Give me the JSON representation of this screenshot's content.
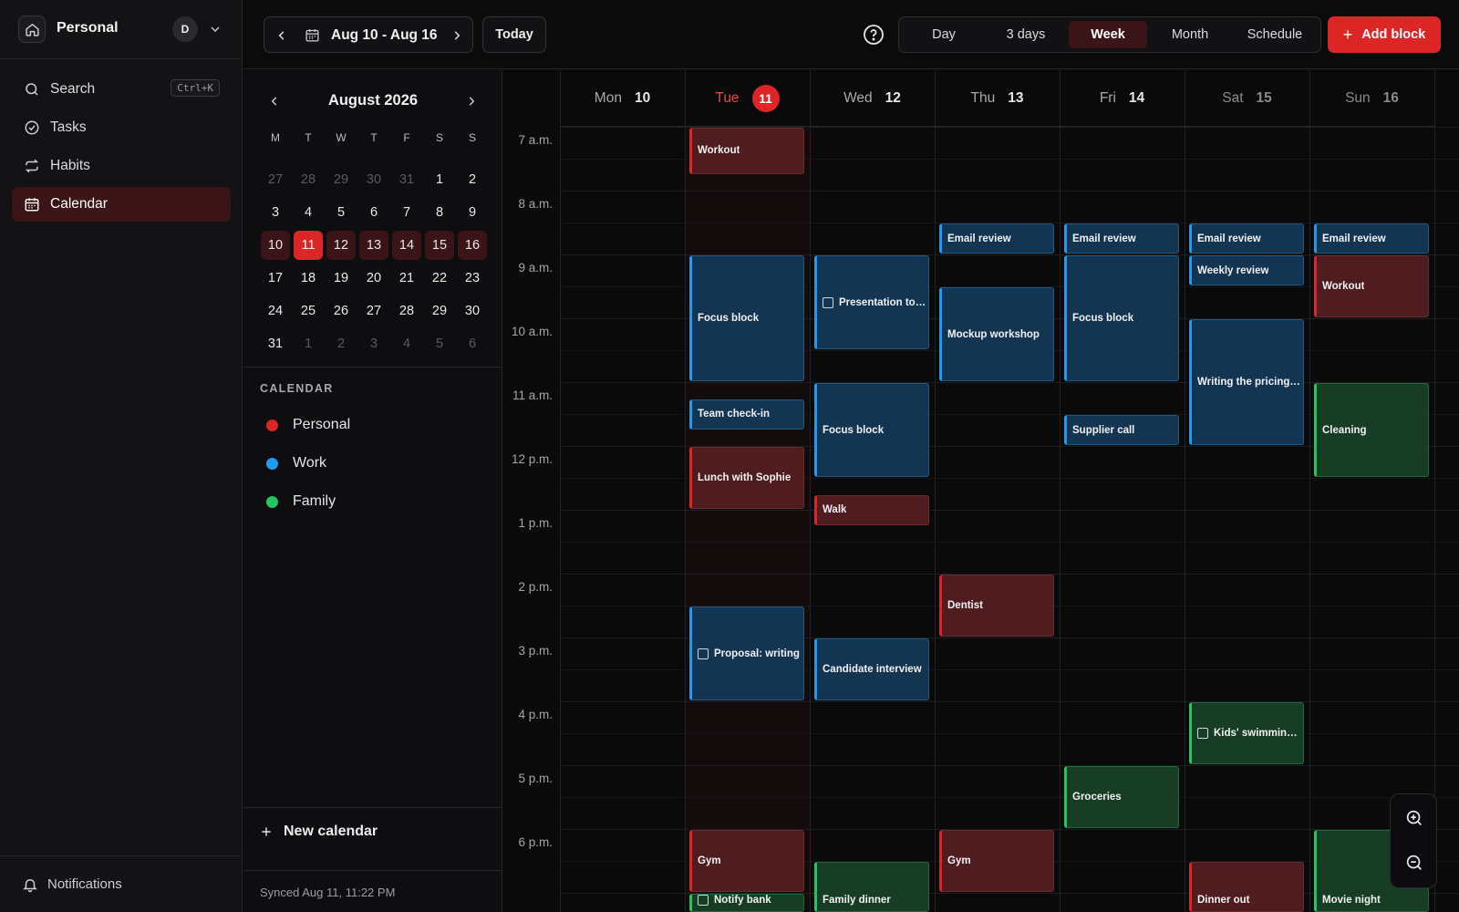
{
  "sidebar": {
    "workspace": {
      "name": "Personal",
      "avatar": "D",
      "home_icon": "home-icon",
      "chevron_icon": "chevron-down-icon"
    },
    "nav": [
      {
        "label": "Search",
        "icon": "search-icon",
        "shortcut": "Ctrl+K",
        "active": false
      },
      {
        "label": "Tasks",
        "icon": "check-circle-icon",
        "active": false
      },
      {
        "label": "Habits",
        "icon": "repeat-icon",
        "active": false
      },
      {
        "label": "Calendar",
        "icon": "calendar-icon",
        "active": true
      }
    ],
    "notifications": {
      "label": "Notifications",
      "icon": "bell-icon"
    }
  },
  "mini_calendar": {
    "title": "August 2026",
    "weekdays": [
      "M",
      "T",
      "W",
      "T",
      "F",
      "S",
      "S"
    ],
    "weeks": [
      [
        {
          "d": "27",
          "muted": true
        },
        {
          "d": "28",
          "muted": true
        },
        {
          "d": "29",
          "muted": true
        },
        {
          "d": "30",
          "muted": true
        },
        {
          "d": "31",
          "muted": true
        },
        {
          "d": "1"
        },
        {
          "d": "2"
        }
      ],
      [
        {
          "d": "3"
        },
        {
          "d": "4"
        },
        {
          "d": "5"
        },
        {
          "d": "6"
        },
        {
          "d": "7"
        },
        {
          "d": "8"
        },
        {
          "d": "9"
        }
      ],
      [
        {
          "d": "10",
          "inweek": true
        },
        {
          "d": "11",
          "today": true
        },
        {
          "d": "12",
          "inweek": true
        },
        {
          "d": "13",
          "inweek": true
        },
        {
          "d": "14",
          "inweek": true
        },
        {
          "d": "15",
          "inweek": true
        },
        {
          "d": "16",
          "inweek": true
        }
      ],
      [
        {
          "d": "17"
        },
        {
          "d": "18"
        },
        {
          "d": "19"
        },
        {
          "d": "20"
        },
        {
          "d": "21"
        },
        {
          "d": "22"
        },
        {
          "d": "23"
        }
      ],
      [
        {
          "d": "24"
        },
        {
          "d": "25"
        },
        {
          "d": "26"
        },
        {
          "d": "27"
        },
        {
          "d": "28"
        },
        {
          "d": "29"
        },
        {
          "d": "30"
        }
      ],
      [
        {
          "d": "31"
        },
        {
          "d": "1",
          "muted": true
        },
        {
          "d": "2",
          "muted": true
        },
        {
          "d": "3",
          "muted": true
        },
        {
          "d": "4",
          "muted": true
        },
        {
          "d": "5",
          "muted": true
        },
        {
          "d": "6",
          "muted": true
        }
      ]
    ]
  },
  "calendars": {
    "heading": "CALENDAR",
    "items": [
      {
        "name": "Personal",
        "color": "#dc2626"
      },
      {
        "name": "Work",
        "color": "#1e9bf0"
      },
      {
        "name": "Family",
        "color": "#22c55e"
      }
    ],
    "new_label": "New calendar",
    "synced": "Synced Aug 11, 11:22 PM"
  },
  "toolbar": {
    "range": "Aug 10 - Aug 16",
    "today_label": "Today",
    "views": [
      "Day",
      "3 days",
      "Week",
      "Month",
      "Schedule"
    ],
    "active_view": "Week",
    "add_label": "Add block"
  },
  "week": {
    "days": [
      {
        "wd": "Mon",
        "dn": "10"
      },
      {
        "wd": "Tue",
        "dn": "11",
        "today": true
      },
      {
        "wd": "Wed",
        "dn": "12"
      },
      {
        "wd": "Thu",
        "dn": "13"
      },
      {
        "wd": "Fri",
        "dn": "14"
      },
      {
        "wd": "Sat",
        "dn": "15",
        "weekend": true
      },
      {
        "wd": "Sun",
        "dn": "16",
        "weekend": true
      }
    ],
    "hours": [
      "7 a.m.",
      "8 a.m.",
      "9 a.m.",
      "10 a.m.",
      "11 a.m.",
      "12 p.m.",
      "1 p.m.",
      "2 p.m.",
      "3 p.m.",
      "4 p.m.",
      "5 p.m.",
      "6 p.m."
    ],
    "events": [
      {
        "day": 1,
        "start": "7:00",
        "end": "7:45",
        "title": "Workout",
        "cal": "red"
      },
      {
        "day": 1,
        "start": "9:00",
        "end": "11:00",
        "title": "Focus block",
        "cal": "blue"
      },
      {
        "day": 1,
        "start": "11:15",
        "end": "11:45",
        "title": "Team check-in",
        "cal": "blue"
      },
      {
        "day": 1,
        "start": "12:00",
        "end": "13:00",
        "title": "Lunch with Sophie",
        "cal": "red"
      },
      {
        "day": 1,
        "start": "14:30",
        "end": "16:00",
        "title": "Proposal: writing",
        "cal": "blue",
        "checkbox": true
      },
      {
        "day": 1,
        "start": "18:00",
        "end": "19:00",
        "title": "Gym",
        "cal": "red"
      },
      {
        "day": 1,
        "start": "19:00",
        "end": "19:30",
        "title": "Notify bank",
        "cal": "green",
        "checkbox": true
      },
      {
        "day": 2,
        "start": "9:00",
        "end": "10:30",
        "title": "Presentation to team",
        "cal": "blue",
        "checkbox": true
      },
      {
        "day": 2,
        "start": "11:00",
        "end": "12:30",
        "title": "Focus block",
        "cal": "blue"
      },
      {
        "day": 2,
        "start": "12:45",
        "end": "13:15",
        "title": "Walk",
        "cal": "red"
      },
      {
        "day": 2,
        "start": "15:00",
        "end": "16:00",
        "title": "Candidate interview",
        "cal": "blue"
      },
      {
        "day": 2,
        "start": "18:30",
        "end": "20:00",
        "title": "Family dinner",
        "cal": "green"
      },
      {
        "day": 3,
        "start": "8:30",
        "end": "9:00",
        "title": "Email review",
        "cal": "blue"
      },
      {
        "day": 3,
        "start": "9:30",
        "end": "11:00",
        "title": "Mockup workshop",
        "cal": "blue"
      },
      {
        "day": 3,
        "start": "14:00",
        "end": "15:00",
        "title": "Dentist",
        "cal": "red"
      },
      {
        "day": 3,
        "start": "18:00",
        "end": "19:00",
        "title": "Gym",
        "cal": "red"
      },
      {
        "day": 4,
        "start": "8:30",
        "end": "9:00",
        "title": "Email review",
        "cal": "blue"
      },
      {
        "day": 4,
        "start": "9:00",
        "end": "11:00",
        "title": "Focus block",
        "cal": "blue"
      },
      {
        "day": 4,
        "start": "11:30",
        "end": "12:00",
        "title": "Supplier call",
        "cal": "blue"
      },
      {
        "day": 4,
        "start": "17:00",
        "end": "18:00",
        "title": "Groceries",
        "cal": "green"
      },
      {
        "day": 5,
        "start": "8:30",
        "end": "9:00",
        "title": "Email review",
        "cal": "blue"
      },
      {
        "day": 5,
        "start": "9:00",
        "end": "9:30",
        "title": "Weekly review",
        "cal": "blue"
      },
      {
        "day": 5,
        "start": "10:00",
        "end": "12:00",
        "title": "Writing the pricing page",
        "cal": "blue"
      },
      {
        "day": 5,
        "start": "16:00",
        "end": "17:00",
        "title": "Kids' swimming lesson",
        "cal": "green",
        "checkbox": true
      },
      {
        "day": 5,
        "start": "18:30",
        "end": "20:00",
        "title": "Dinner out",
        "cal": "red"
      },
      {
        "day": 6,
        "start": "8:30",
        "end": "9:00",
        "title": "Email review",
        "cal": "blue"
      },
      {
        "day": 6,
        "start": "9:00",
        "end": "10:00",
        "title": "Workout",
        "cal": "red"
      },
      {
        "day": 6,
        "start": "11:00",
        "end": "12:30",
        "title": "Cleaning",
        "cal": "green"
      },
      {
        "day": 6,
        "start": "18:00",
        "end": "20:00",
        "title": "Movie night",
        "cal": "green"
      }
    ]
  },
  "zoom": {
    "in_icon": "zoom-in-icon",
    "out_icon": "zoom-out-icon"
  }
}
